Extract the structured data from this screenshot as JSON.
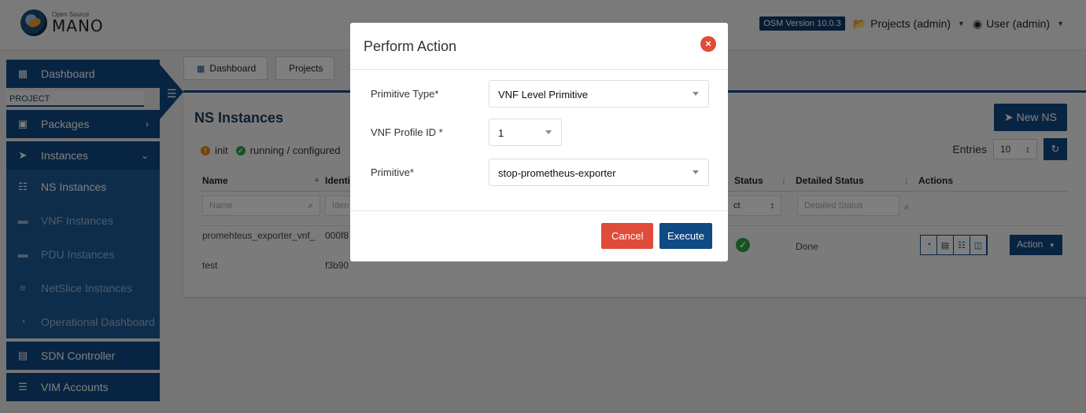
{
  "header": {
    "logo_small": "Open Source",
    "logo_big": "MANO",
    "version": "OSM Version 10.0.3",
    "projects": "Projects (admin)",
    "user": "User (admin)"
  },
  "sidebar": {
    "dashboard": "Dashboard",
    "project_label": "PROJECT",
    "packages": "Packages",
    "instances": "Instances",
    "sub_items": [
      {
        "label": "NS Instances",
        "icon": "sitemap-icon"
      },
      {
        "label": "VNF Instances",
        "icon": "server-icon"
      },
      {
        "label": "PDU Instances",
        "icon": "server-icon"
      },
      {
        "label": "NetSlice Instances",
        "icon": "layers-icon"
      },
      {
        "label": "Operational Dashboard",
        "icon": "tachometer-icon"
      }
    ],
    "sdn_controller": "SDN Controller",
    "vim_accounts": "VIM Accounts"
  },
  "breadcrumb": [
    "Dashboard",
    "Projects"
  ],
  "page": {
    "title": "NS Instances",
    "new_button": "New NS",
    "legend": [
      {
        "label": "init",
        "color": "#e98a15"
      },
      {
        "label": "running / configured",
        "color": "#28a745"
      }
    ],
    "entries_label": "Entries",
    "entries_value": "10"
  },
  "table": {
    "headers": {
      "name": "Name",
      "identifier": "Identi",
      "config_status": "Status",
      "detailed_status": "Detailed Status",
      "actions": "Actions"
    },
    "filters": {
      "name": "Name",
      "identifier": "Iden",
      "config_status": "ct",
      "detailed_status": "Detailed Status"
    },
    "rows": [
      {
        "name_line1": "promehteus_exporter_vnf_",
        "name_line2": "test",
        "id_line1": "000f8",
        "id_line2": "f3b90",
        "detailed_status": "Done",
        "action_label": "Action"
      }
    ]
  },
  "modal": {
    "title": "Perform Action",
    "fields": {
      "primitive_type_label": "Primitive Type*",
      "primitive_type_value": "VNF Level Primitive",
      "vnf_profile_label": "VNF Profile ID *",
      "vnf_profile_value": "1",
      "primitive_label": "Primitive*",
      "primitive_value": "stop-prometheus-exporter"
    },
    "cancel": "Cancel",
    "execute": "Execute"
  },
  "colors": {
    "primary": "#0f4a84",
    "danger": "#e04b3a",
    "success": "#28a745"
  }
}
